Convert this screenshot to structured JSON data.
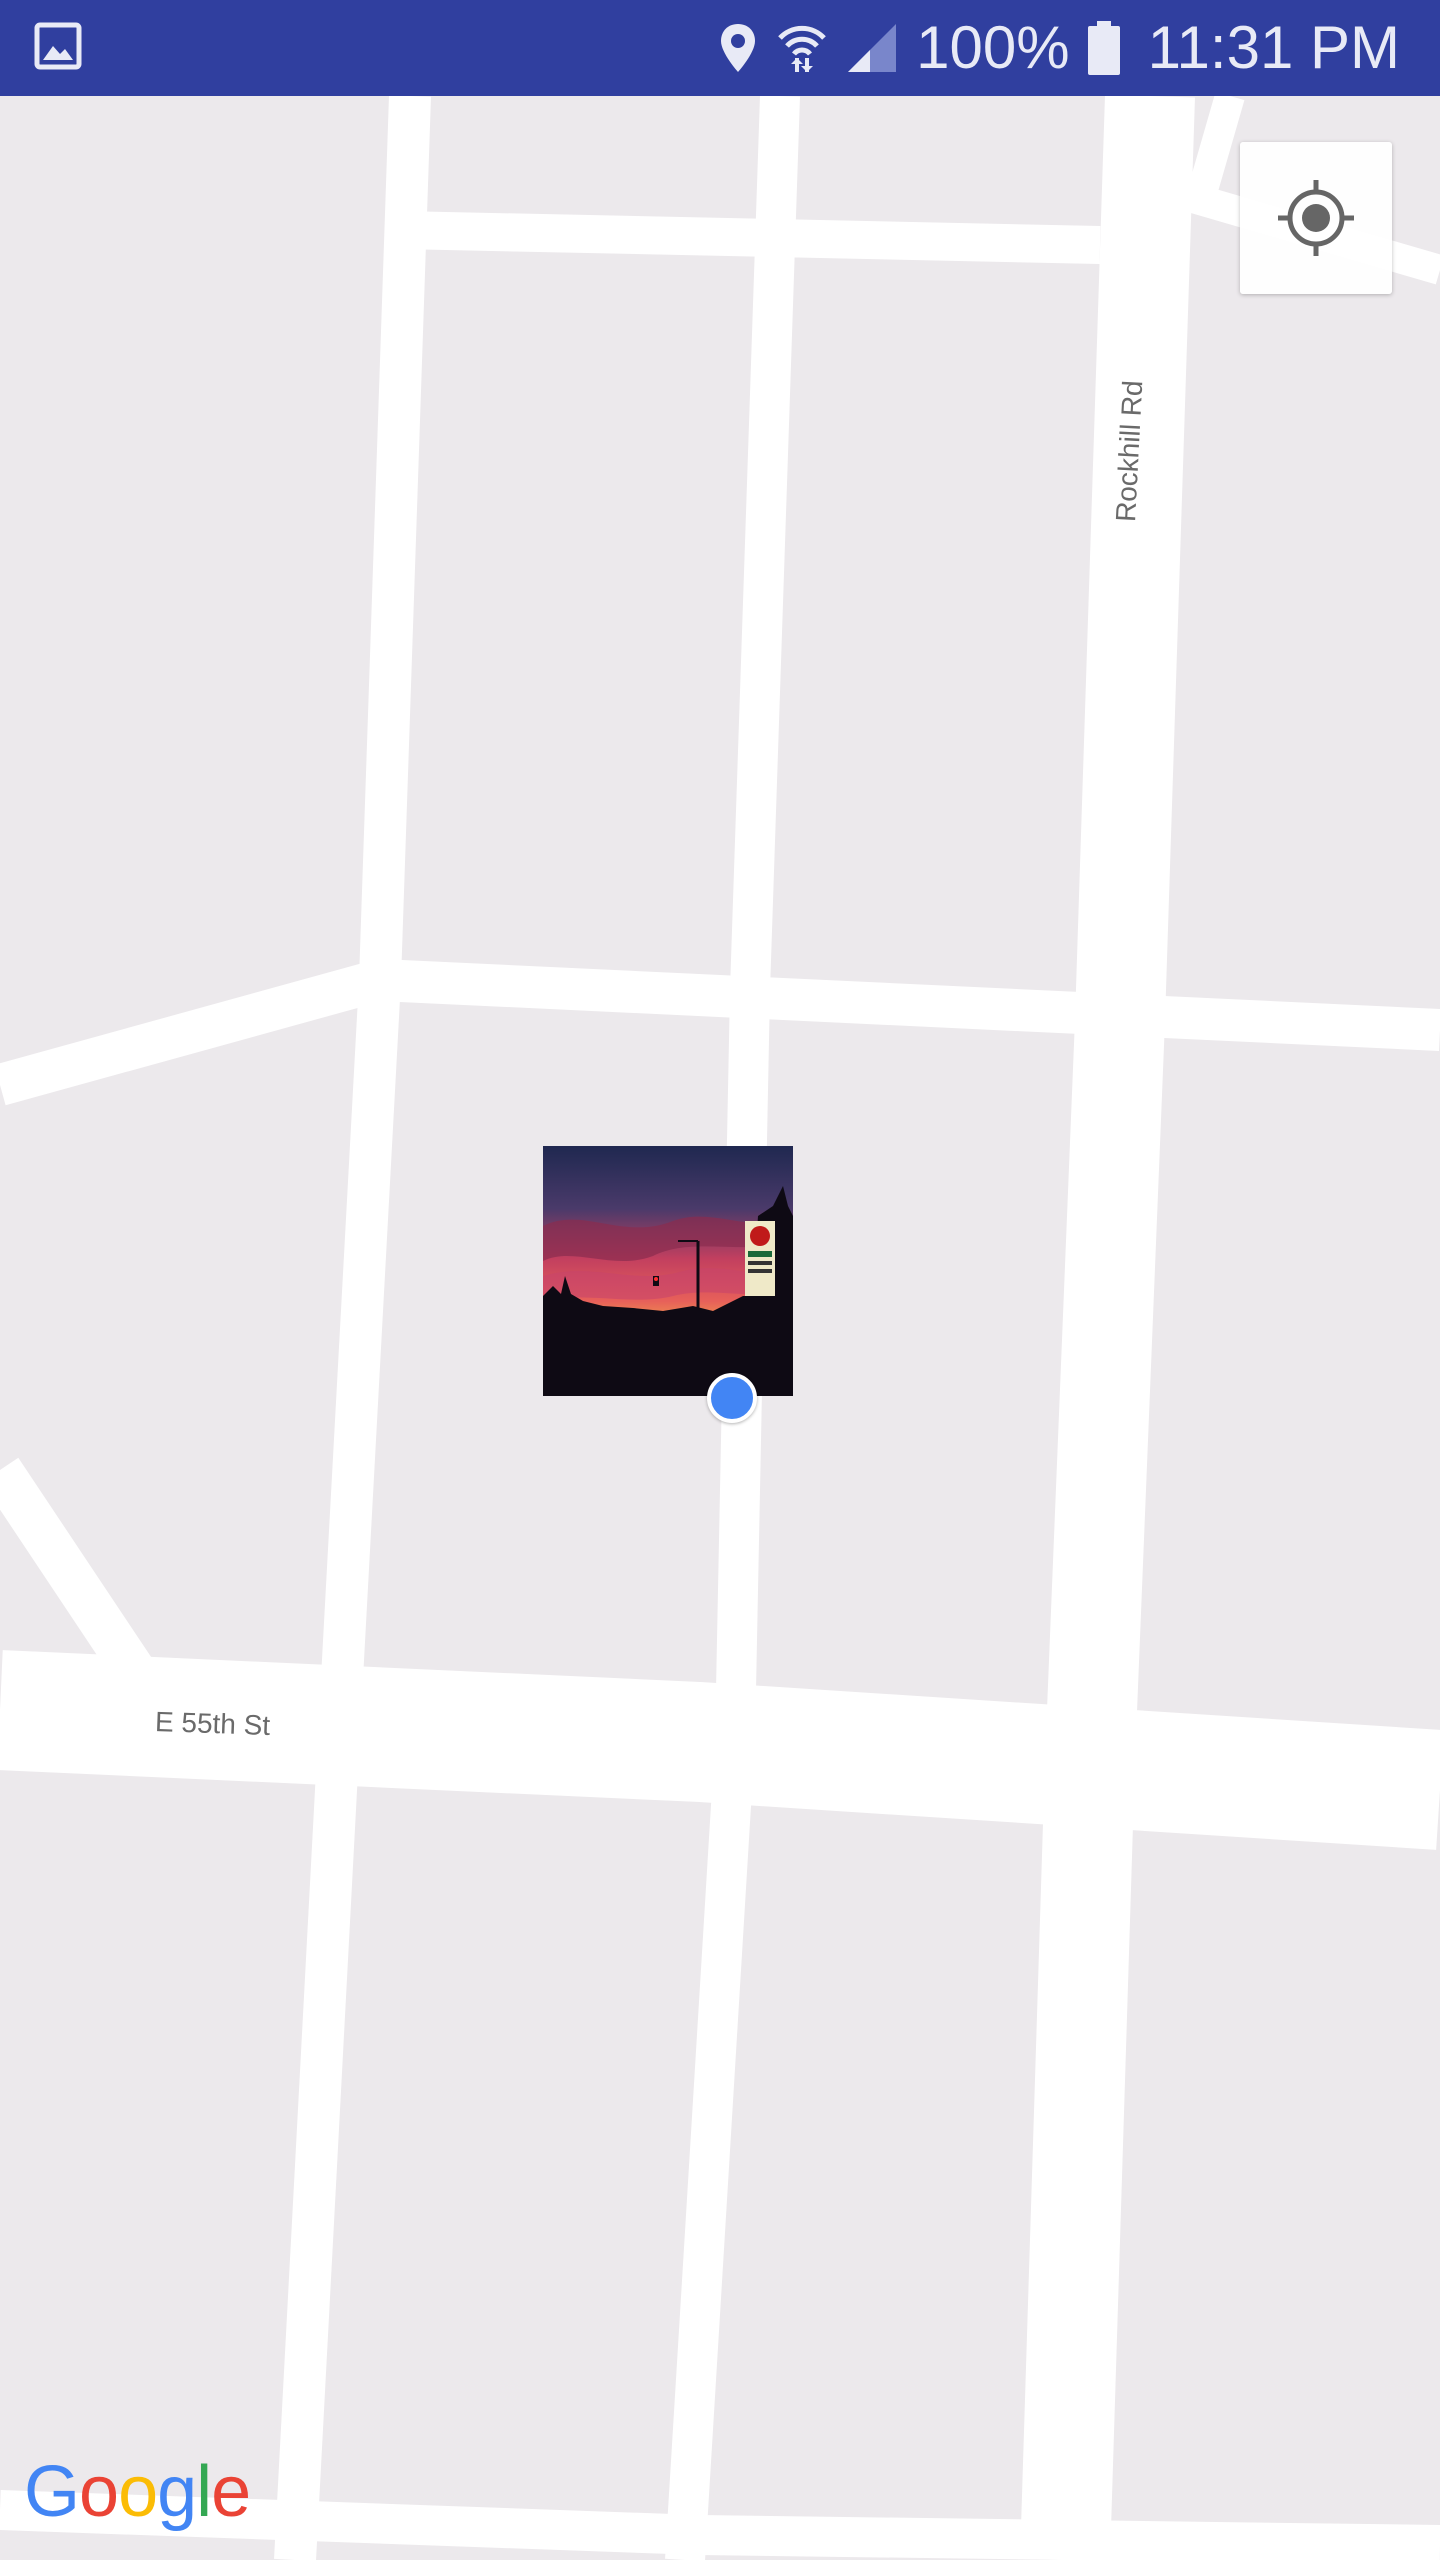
{
  "status_bar": {
    "left_icons": [
      "gallery-icon"
    ],
    "right_icons": [
      "location-pin-icon",
      "wifi-icon",
      "cell-signal-icon",
      "battery-icon"
    ],
    "battery_text": "100%",
    "time": "11:31 PM",
    "background_color": "#303f9f"
  },
  "map": {
    "background_color": "#ece9ec",
    "road_color": "#ffffff",
    "roads": {
      "rockhill": "Rockhill Rd",
      "e55th": "E 55th St"
    },
    "my_location_button": {
      "icon": "crosshair-target-icon"
    },
    "photo_marker": {
      "icon": "photo-thumbnail",
      "description_colors": [
        "#1c2340",
        "#d9465e",
        "#f39a3a"
      ]
    },
    "current_location": {
      "color": "#4285f4"
    },
    "attribution": {
      "letters": [
        "G",
        "o",
        "o",
        "g",
        "l",
        "e"
      ],
      "colors": [
        "#4285f4",
        "#ea4335",
        "#fbbc05",
        "#4285f4",
        "#34a853",
        "#ea4335"
      ]
    }
  }
}
